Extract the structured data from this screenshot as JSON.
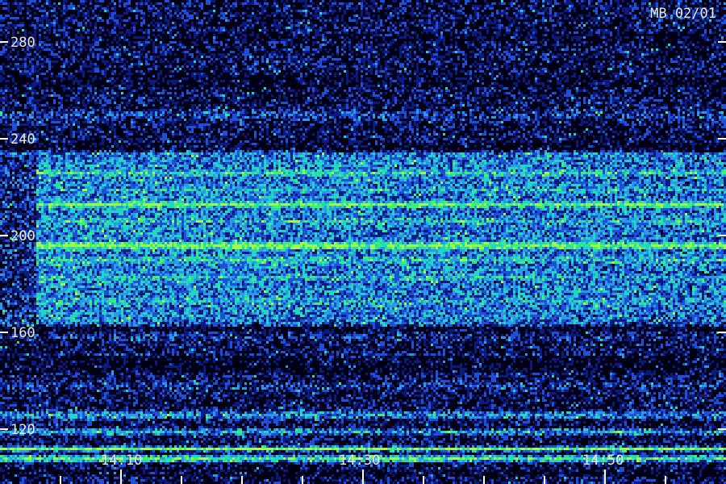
{
  "chart_data": {
    "type": "heatmap",
    "title": "MB 02/01",
    "xlabel": "",
    "ylabel": "",
    "y_ticks": [
      280,
      240,
      200,
      160,
      120
    ],
    "ylim": [
      110,
      290
    ],
    "x_ticks": [
      "14:10",
      "14:30",
      "14:50"
    ],
    "colormap": [
      "#000020",
      "#0a1a80",
      "#1f4fd8",
      "#2a9ae8",
      "#20d8c0",
      "#40f070",
      "#a0ff40"
    ],
    "bands": [
      {
        "y": 285,
        "width": 4,
        "intensity": 0.15
      },
      {
        "y": 280,
        "width": 4,
        "intensity": 0.1
      },
      {
        "y": 270,
        "width": 6,
        "intensity": 0.08
      },
      {
        "y": 262,
        "width": 3,
        "intensity": 0.12
      },
      {
        "y": 250,
        "width": 6,
        "intensity": 0.3
      },
      {
        "y": 235,
        "width": 3,
        "intensity": 0.2
      },
      {
        "y": 226,
        "width": 4,
        "intensity": 0.7
      },
      {
        "y": 219,
        "width": 4,
        "intensity": 0.6
      },
      {
        "y": 213,
        "width": 3,
        "intensity": 0.95
      },
      {
        "y": 206,
        "width": 4,
        "intensity": 0.65
      },
      {
        "y": 196,
        "width": 4,
        "intensity": 0.95
      },
      {
        "y": 190,
        "width": 5,
        "intensity": 0.65
      },
      {
        "y": 183,
        "width": 6,
        "intensity": 0.6
      },
      {
        "y": 173,
        "width": 8,
        "intensity": 0.55
      },
      {
        "y": 164,
        "width": 3,
        "intensity": 0.4
      },
      {
        "y": 158,
        "width": 4,
        "intensity": 0.25
      },
      {
        "y": 150,
        "width": 3,
        "intensity": 0.3
      },
      {
        "y": 138,
        "width": 6,
        "intensity": 0.25
      },
      {
        "y": 126,
        "width": 4,
        "intensity": 0.5
      },
      {
        "y": 119,
        "width": 3,
        "intensity": 0.55
      },
      {
        "y": 112,
        "width": 2,
        "intensity": 0.95
      },
      {
        "y": 108,
        "width": 3,
        "intensity": 0.8
      }
    ]
  }
}
